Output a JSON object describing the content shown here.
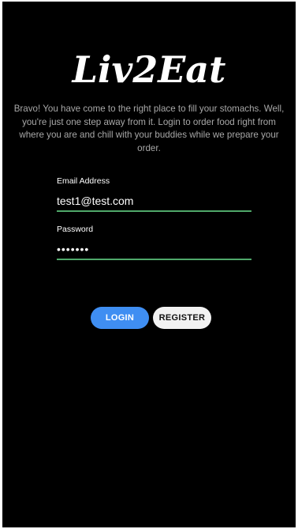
{
  "app": {
    "logo_text": "Liv2Eat",
    "tagline": "Bravo! You have come to the right place to fill your stomachs. Well, you're just one step away from it. Login to order food right from where you are and chill with your buddies while we prepare your order."
  },
  "form": {
    "email": {
      "label": "Email Address",
      "value": "test1@test.com"
    },
    "password": {
      "label": "Password",
      "masked_value": "•••••••"
    }
  },
  "buttons": {
    "login_label": "LOGIN",
    "register_label": "REGISTER"
  },
  "colors": {
    "background": "#000000",
    "input_underline": "#4fa86a",
    "login_button": "#3f8ef2",
    "register_button": "#f2f2f2"
  }
}
